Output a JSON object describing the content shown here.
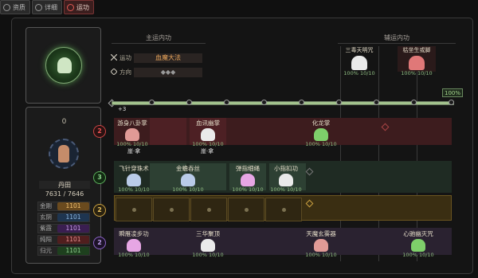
{
  "tabs": [
    {
      "label": "资质",
      "active": false
    },
    {
      "label": "详细",
      "active": false
    },
    {
      "label": "运功",
      "active": true
    }
  ],
  "left": {
    "skill_icon": "lotus-hand-icon",
    "count": "0",
    "dantian_label": "丹田",
    "hp": "7631 / 7646",
    "stats": [
      {
        "label": "金刚",
        "value": "1101",
        "color": "#c48a3a"
      },
      {
        "label": "玄阴",
        "value": "1101",
        "color": "#3a5f86"
      },
      {
        "label": "紫霞",
        "value": "1101",
        "color": "#6a3a86"
      },
      {
        "label": "纯阳",
        "value": "1101",
        "color": "#8a3a3a"
      },
      {
        "label": "归元",
        "value": "1101",
        "color": "#3a7a3a"
      }
    ]
  },
  "main": {
    "header": "主运内功",
    "yungong_label": "运功",
    "yungong_value": "血魔大法",
    "fangxiang_label": "方向",
    "fangxiang_value": "◆◆◆",
    "plus3": "+3",
    "progress_pct": 100,
    "progress_label": "100%"
  },
  "aux": {
    "header": "辅运内功",
    "items": [
      {
        "name": "三毒天明咒",
        "progress": "100% 10/10",
        "icon_color": "#eaeaea"
      },
      {
        "name": "枯坐生或脚",
        "progress": "100% 10/10",
        "icon_color": "#e07878"
      }
    ]
  },
  "rows": [
    {
      "level": "2",
      "type": "red"
    },
    {
      "level": "3",
      "type": "green"
    },
    {
      "level": "2",
      "type": "gold"
    },
    {
      "level": "2",
      "type": "purple"
    }
  ],
  "gongfa": {
    "row1": [
      {
        "name": "游身八卦掌",
        "progress": "100% 10/10",
        "icon": "red"
      },
      {
        "name": "血讯幽掌",
        "progress": "100% 10/10",
        "icon": "white"
      },
      {
        "name": "化龙掌",
        "progress": "100% 10/10",
        "icon": "green"
      }
    ],
    "row1_minis": [
      "崖·拿",
      "崖·拿"
    ],
    "row2": [
      {
        "name": "飞针穿珠术",
        "progress": "100% 10/10",
        "icon": "blue"
      },
      {
        "name": "金蟾吞丝",
        "progress": "100% 10/10",
        "icon": "blue"
      },
      {
        "name": "弹指细绳",
        "progress": "100% 10/10",
        "icon": "pink"
      },
      {
        "name": "小指扣功",
        "progress": "100% 10/10",
        "icon": "white"
      }
    ],
    "row4": [
      {
        "name": "瞬雁凌步功",
        "progress": "100% 10/10",
        "icon": "pink"
      },
      {
        "name": "三华聚顶",
        "progress": "100% 10/10",
        "icon": "white"
      },
      {
        "name": "天魔玄雾器",
        "progress": "100% 10/10",
        "icon": "red"
      },
      {
        "name": "心驰幽灭咒",
        "progress": "100% 10/10",
        "icon": "green"
      }
    ]
  }
}
